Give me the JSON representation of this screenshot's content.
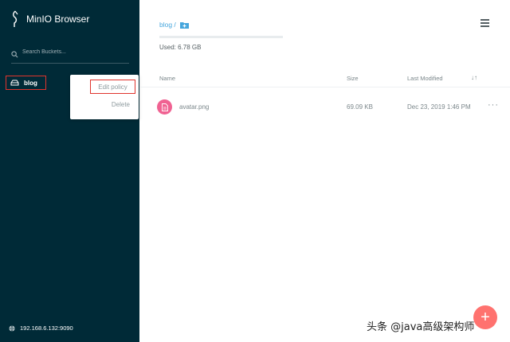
{
  "app": {
    "title": "MinIO Browser",
    "logo_icon": "minio-logo-icon"
  },
  "search": {
    "placeholder": "Search Buckets..."
  },
  "buckets": [
    {
      "name": "blog",
      "icon": "hard-drive-icon"
    }
  ],
  "context_menu": {
    "edit_label": "Edit policy",
    "delete_label": "Delete"
  },
  "host": {
    "address": "192.168.6.132:9090"
  },
  "breadcrumb": {
    "path": "blog /"
  },
  "usage": {
    "label": "Used: 6.78 GB",
    "fraction": 0.0
  },
  "table": {
    "columns": {
      "name": "Name",
      "size": "Size",
      "modified": "Last Modified"
    },
    "rows": [
      {
        "name": "avatar.png",
        "size": "69.09 KB",
        "modified": "Dec 23, 2019 1:46 PM",
        "more": "···"
      }
    ]
  },
  "fab": {
    "label": "+"
  },
  "watermark": {
    "text": "头条 @java高级架构师"
  },
  "colors": {
    "sidebar": "#002a37",
    "accent": "#46a6dd",
    "highlight": "#e0342d",
    "file_icon": "#f06292",
    "fab": "#ff726f"
  }
}
